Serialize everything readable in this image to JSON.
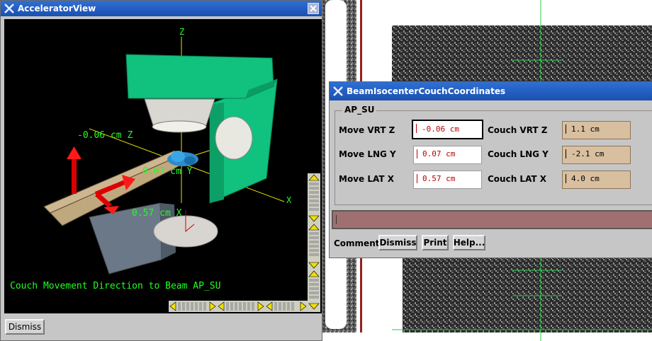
{
  "accelerator_window": {
    "title": "AcceleratorView",
    "axis_z": "Z",
    "axis_x": "X",
    "label_z": "-0.06 cm Z",
    "label_y": "0.07 cm Y",
    "label_x": "0.57 cm X",
    "caption": "Couch Movement Direction to Beam AP_SU",
    "dismiss_label": "Dismiss"
  },
  "coords_window": {
    "title": "BeamIsocenterCouchCoordinates",
    "group_label": "AP_SU",
    "rows": [
      {
        "move_label": "Move VRT Z",
        "move_value": "-0.06 cm",
        "couch_label": "Couch VRT Z",
        "couch_value": "1.1 cm"
      },
      {
        "move_label": "Move LNG Y",
        "move_value": "0.07 cm",
        "couch_label": "Couch LNG Y",
        "couch_value": "-2.1 cm"
      },
      {
        "move_label": "Move LAT X",
        "move_value": "0.57 cm",
        "couch_label": "Couch LAT X",
        "couch_value": "4.0 cm"
      }
    ],
    "comment_label": "Comment",
    "dismiss_label": "Dismiss",
    "print_label": "Print",
    "help_label": "Help..."
  },
  "colors": {
    "gantry": "#0fbf7a",
    "couch": "#c8b088",
    "arrow": "#e00000",
    "axis_label": "#22ff22"
  }
}
